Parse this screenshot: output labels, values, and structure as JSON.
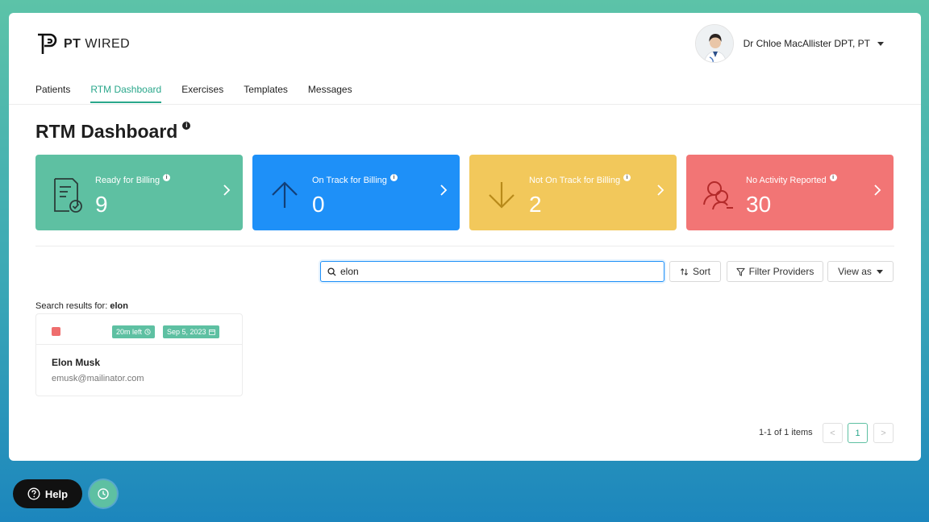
{
  "brand": {
    "bold": "PT",
    "rest": " WIRED"
  },
  "user": {
    "name": "Dr Chloe MacAllister DPT, PT"
  },
  "nav": {
    "items": [
      {
        "label": "Patients"
      },
      {
        "label": "RTM Dashboard"
      },
      {
        "label": "Exercises"
      },
      {
        "label": "Templates"
      },
      {
        "label": "Messages"
      }
    ],
    "active": "RTM Dashboard"
  },
  "page": {
    "title": "RTM Dashboard",
    "info_icon": "info-icon"
  },
  "stats": [
    {
      "label": "Ready for Billing",
      "value": "9",
      "icon": "document-check-icon",
      "color": "#5ec0a2"
    },
    {
      "label": "On Track for Billing",
      "value": "0",
      "icon": "arrow-up-icon",
      "color": "#1e90f8"
    },
    {
      "label": "Not On Track for Billing",
      "value": "2",
      "icon": "arrow-down-icon",
      "color": "#f2c85b"
    },
    {
      "label": "No Activity Reported",
      "value": "30",
      "icon": "user-remove-icon",
      "color": "#f27575"
    }
  ],
  "toolbar": {
    "search_value": "elon",
    "sort_label": "Sort",
    "filter_label": "Filter Providers",
    "view_label": "View as"
  },
  "results": {
    "prefix": "Search results for: ",
    "query": "elon",
    "items": [
      {
        "time_left": "20m left",
        "date": "Sep 5, 2023",
        "name": "Elon Musk",
        "email": "emusk@mailinator.com",
        "status_color": "#ef6e6e"
      }
    ]
  },
  "pagination": {
    "summary": "1-1 of 1 items",
    "current_page": "1",
    "prev": "<",
    "next": ">"
  },
  "help": {
    "label": "Help"
  }
}
